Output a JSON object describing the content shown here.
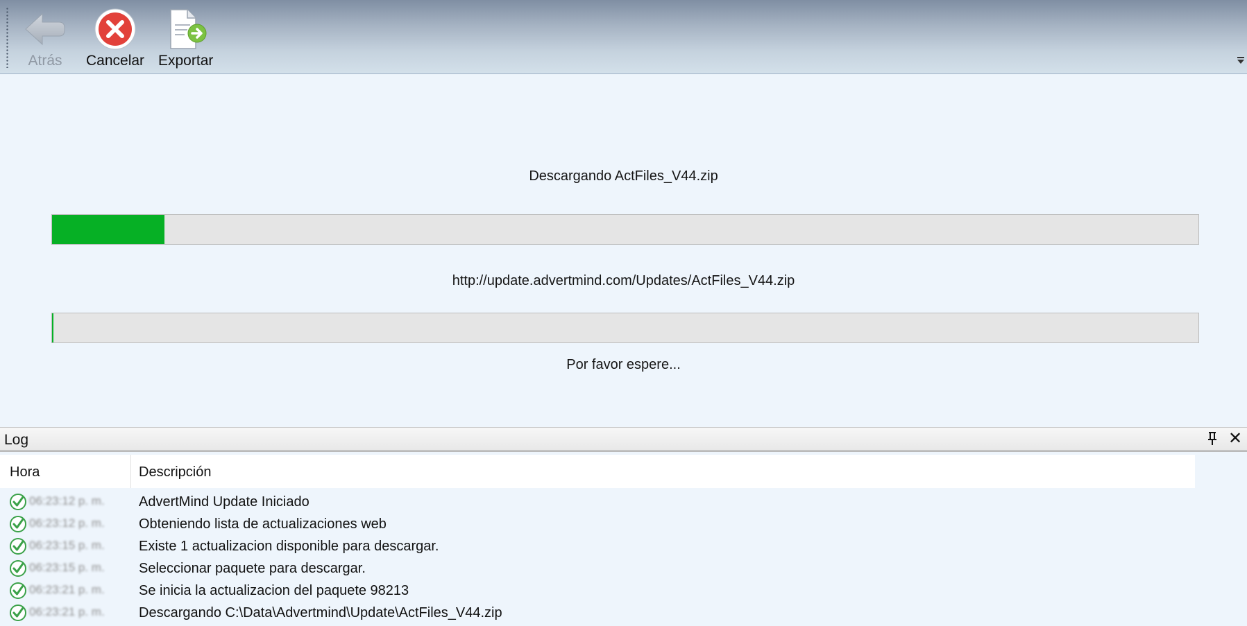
{
  "toolbar": {
    "back_label": "Atrás",
    "cancel_label": "Cancelar",
    "export_label": "Exportar"
  },
  "download": {
    "status": "Descargando ActFiles_V44.zip",
    "url": "http://update.advertmind.com/Updates/ActFiles_V44.zip",
    "wait_message": "Por favor espere...",
    "overall_progress_fraction": 0.098,
    "file_progress_fraction": 0.001
  },
  "log": {
    "title": "Log",
    "columns": {
      "time": "Hora",
      "description": "Descripción"
    },
    "rows": [
      {
        "time": "06:23:12 p. m.",
        "description": "AdvertMind Update Iniciado"
      },
      {
        "time": "06:23:12 p. m.",
        "description": "Obteniendo lista de actualizaciones web"
      },
      {
        "time": "06:23:15 p. m.",
        "description": "Existe 1 actualizacion disponible para descargar."
      },
      {
        "time": "06:23:15 p. m.",
        "description": "Seleccionar paquete para descargar."
      },
      {
        "time": "06:23:21 p. m.",
        "description": "Se inicia la actualizacion del paquete 98213"
      },
      {
        "time": "06:23:21 p. m.",
        "description": "Descargando C:\\Data\\Advertmind\\Update\\ActFiles_V44.zip"
      }
    ]
  },
  "icons": {
    "back": "arrow-left-icon",
    "cancel": "cancel-circle-icon",
    "export": "export-document-icon",
    "pin": "pin-icon",
    "close": "close-icon",
    "row_status": "check-circle-icon"
  },
  "colors": {
    "progress_fill": "#06b025",
    "cancel_red": "#e2413a",
    "export_green": "#7cc242",
    "check_green": "#3aa148"
  }
}
